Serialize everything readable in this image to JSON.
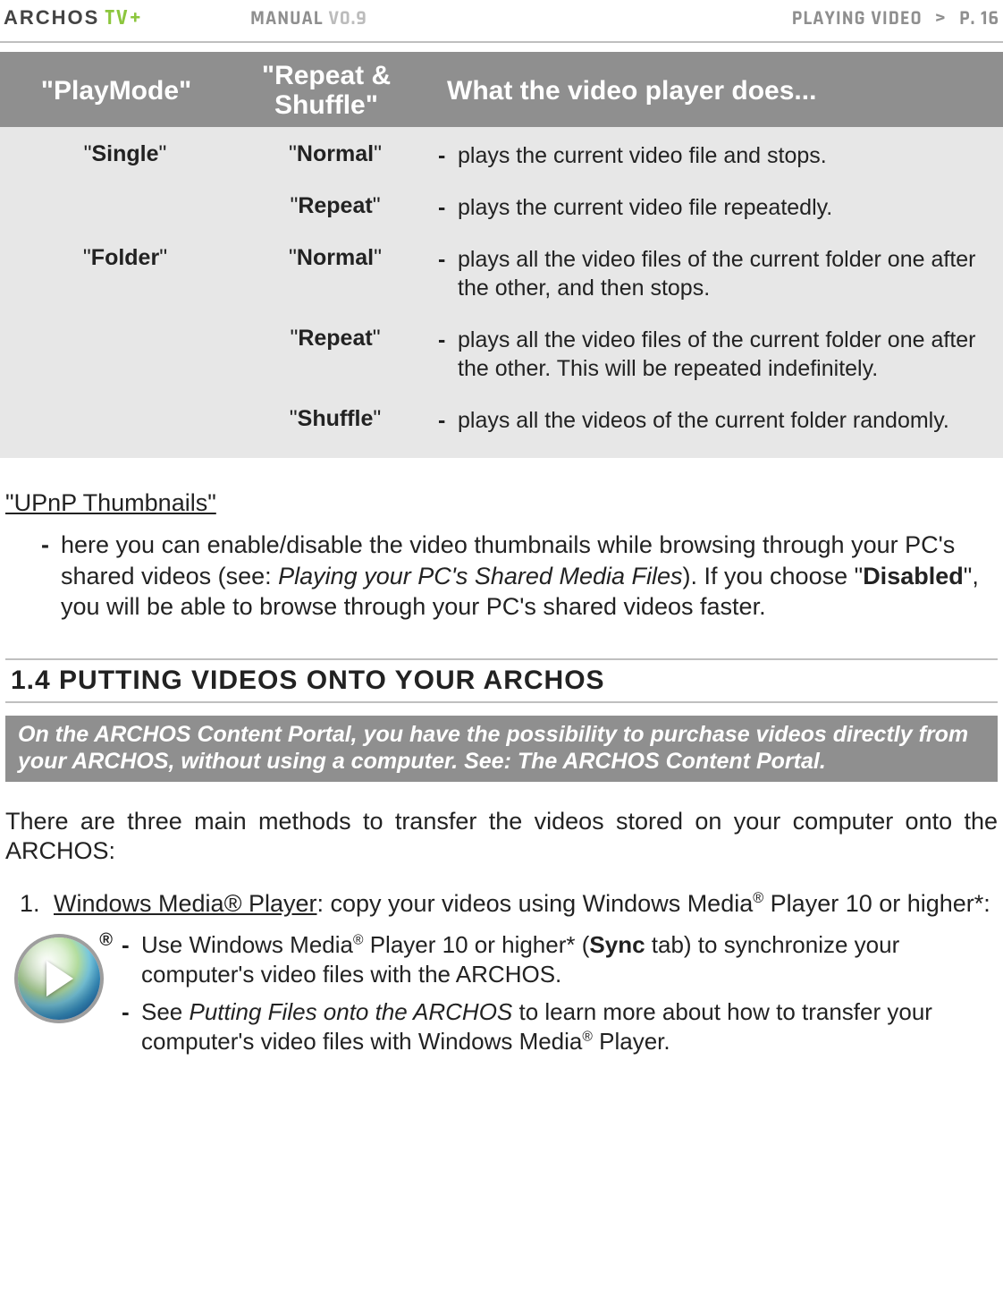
{
  "header": {
    "brand_logo_text": "ARCHOS",
    "product_tag": "TV+",
    "manual_label": "MANUAL",
    "manual_version": "V0.9",
    "section_label": "PLAYING VIDEO",
    "bc_sep": ">",
    "page_label": "P. 16"
  },
  "table": {
    "headers": {
      "col1": "\"PlayMode\"",
      "col2_line1": "\"Repeat &",
      "col2_line2": "Shuffle\"",
      "col3": "What the video player does..."
    },
    "rows": [
      {
        "play": "Single",
        "shuffle": "Normal",
        "desc": "plays the current video file and stops."
      },
      {
        "play": "",
        "shuffle": "Repeat",
        "desc": "plays the current video file repeatedly."
      },
      {
        "play": "Folder",
        "shuffle": "Normal",
        "desc": "plays all the video files of the current folder one after the other, and then stops."
      },
      {
        "play": "",
        "shuffle": "Repeat",
        "desc": "plays all the video files of the current folder one after the other. This will be repeated indefinitely."
      },
      {
        "play": "",
        "shuffle": "Shuffle",
        "desc": "plays all the videos of the current folder randomly."
      }
    ]
  },
  "upnp": {
    "heading": "\"UPnP Thumbnails\"",
    "text_pre": "here you can enable/disable the video thumbnails while browsing through your PC's shared videos (see: ",
    "text_link": "Playing your PC's Shared Media Files",
    "text_mid": "). If you choose \"",
    "text_bold": "Disabled",
    "text_post": "\", you will be able to browse through your PC's shared videos faster."
  },
  "section": {
    "number_title": "1.4  PUTTING VIDEOS ONTO YOUR ARCHOS"
  },
  "callout": "On the ARCHOS Content Portal, you have the possibility to purchase videos directly from your ARCHOS, without using a computer. See: The ARCHOS Content Portal.",
  "intro_para": "There are three main methods to transfer the videos stored on your computer onto the ARCHOS:",
  "method1": {
    "num": "1.",
    "link": "Windows Media® Player",
    "rest": ": copy your videos using Windows Media",
    "reg": "®",
    "tail": " Player 10 or higher*:",
    "bullets": [
      {
        "pre": "Use Windows Media",
        "reg1": "®",
        "mid": " Player 10 or higher* (",
        "bold": "Sync",
        "post": " tab) to synchronize your computer's video files with the ARCHOS."
      },
      {
        "pre": "See ",
        "italic": "Putting Files onto the ARCHOS",
        "mid": " to learn more about how to transfer your computer's video files with Windows Media",
        "reg1": "®",
        "post": " Player."
      }
    ]
  }
}
